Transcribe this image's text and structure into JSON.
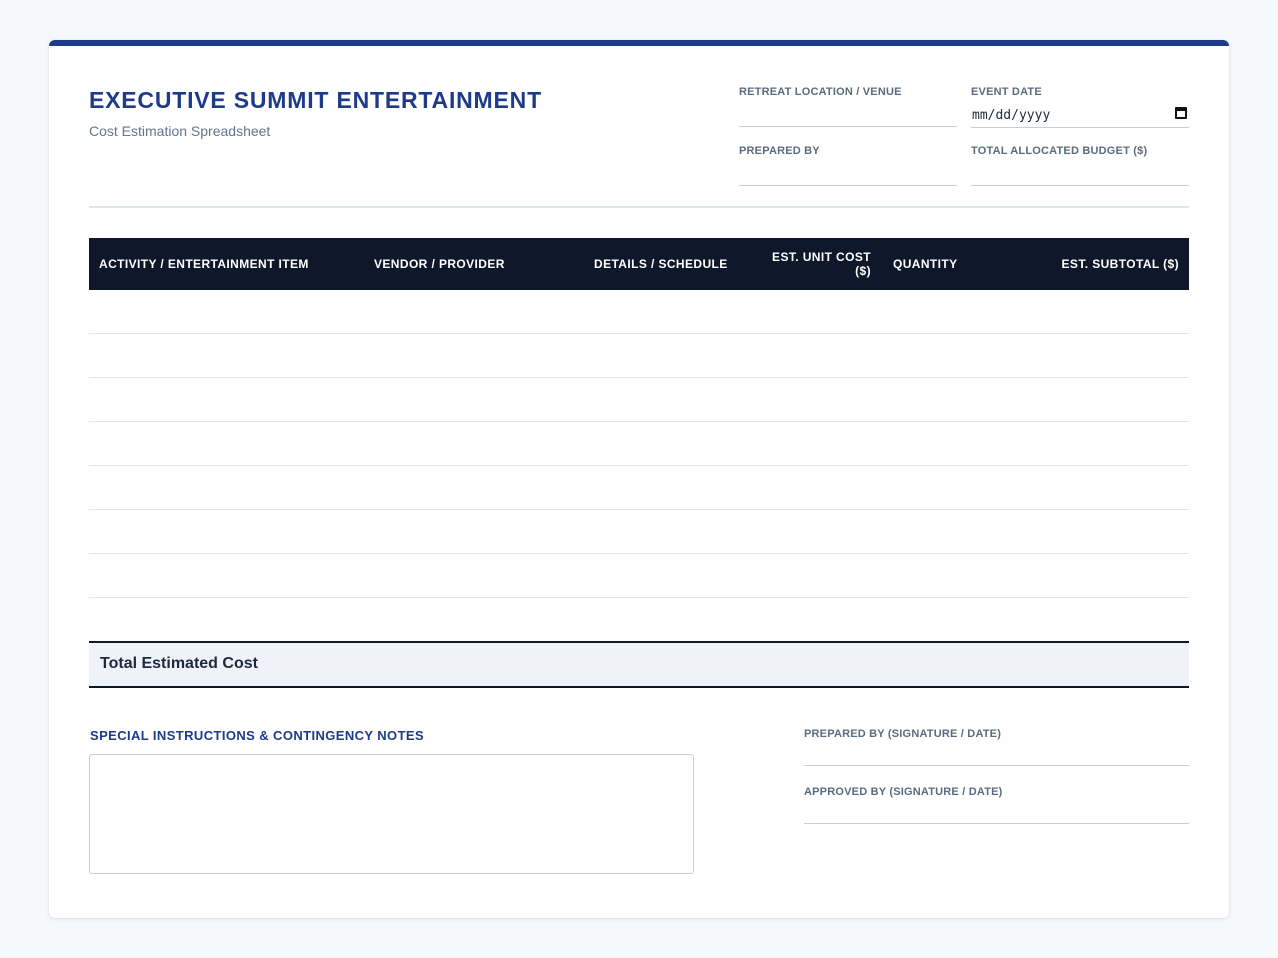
{
  "header": {
    "title": "EXECUTIVE SUMMIT ENTERTAINMENT",
    "subtitle": "Cost Estimation Spreadsheet"
  },
  "meta": {
    "location_label": "RETREAT LOCATION / VENUE",
    "date_label": "EVENT DATE",
    "date_placeholder": "mm/dd/yyyy",
    "prepared_label": "PREPARED BY",
    "budget_label": "TOTAL ALLOCATED BUDGET ($)"
  },
  "table": {
    "columns": [
      "ACTIVITY / ENTERTAINMENT ITEM",
      "VENDOR / PROVIDER",
      "DETAILS / SCHEDULE",
      "EST. UNIT COST ($)",
      "QUANTITY",
      "EST. SUBTOTAL ($)"
    ],
    "rows": [
      [
        "",
        "",
        "",
        "",
        "",
        ""
      ],
      [
        "",
        "",
        "",
        "",
        "",
        ""
      ],
      [
        "",
        "",
        "",
        "",
        "",
        ""
      ],
      [
        "",
        "",
        "",
        "",
        "",
        ""
      ],
      [
        "",
        "",
        "",
        "",
        "",
        ""
      ],
      [
        "",
        "",
        "",
        "",
        "",
        ""
      ],
      [
        "",
        "",
        "",
        "",
        "",
        ""
      ]
    ],
    "total_label": "Total Estimated Cost"
  },
  "notes": {
    "title": "SPECIAL INSTRUCTIONS & CONTINGENCY NOTES",
    "value": ""
  },
  "signatures": {
    "prepared_label": "PREPARED BY (SIGNATURE / DATE)",
    "approved_label": "APPROVED BY (SIGNATURE / DATE)"
  },
  "colors": {
    "accent": "#1e3a8a",
    "table_header": "#0f172a",
    "page_bg": "#f6f8fb"
  }
}
